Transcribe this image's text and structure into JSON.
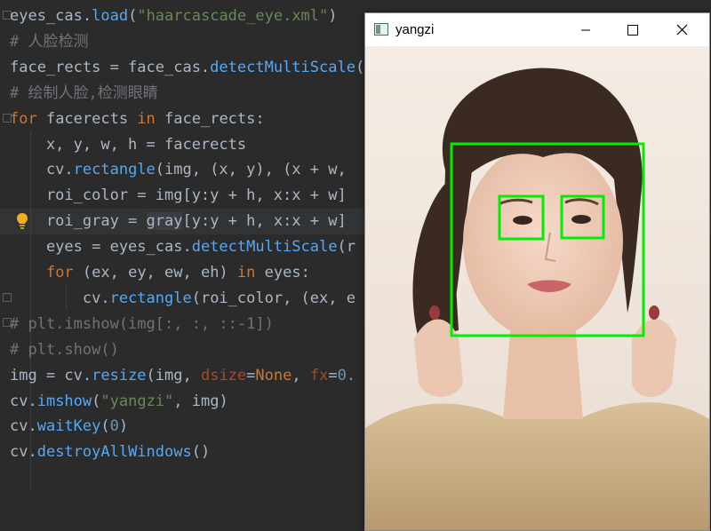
{
  "editor": {
    "lines": [
      {
        "parts": [
          {
            "t": "eyes_cas.",
            "c": ""
          },
          {
            "t": "load",
            "c": "fn"
          },
          {
            "t": "(",
            "c": ""
          },
          {
            "t": "\"haarcascade_eye.xml\"",
            "c": "str"
          },
          {
            "t": ")",
            "c": ""
          }
        ]
      },
      {
        "parts": [
          {
            "t": "# 人脸检测",
            "c": "cmt"
          }
        ]
      },
      {
        "parts": [
          {
            "t": "face_rects = face_cas.",
            "c": ""
          },
          {
            "t": "detectMultiScale",
            "c": "fn"
          },
          {
            "t": "(",
            "c": ""
          }
        ]
      },
      {
        "parts": [
          {
            "t": "# 绘制人脸,检测眼睛",
            "c": "cmt"
          }
        ]
      },
      {
        "parts": [
          {
            "t": "for",
            "c": "kw"
          },
          {
            "t": " facerects ",
            "c": ""
          },
          {
            "t": "in",
            "c": "kw"
          },
          {
            "t": " face_rects:",
            "c": ""
          }
        ]
      },
      {
        "parts": [
          {
            "t": "    x, y, w, h = facerects",
            "c": ""
          }
        ]
      },
      {
        "parts": [
          {
            "t": "    cv.",
            "c": ""
          },
          {
            "t": "rectangle",
            "c": "fn"
          },
          {
            "t": "(img, (x, y), (x + w,",
            "c": ""
          }
        ]
      },
      {
        "parts": [
          {
            "t": "    roi_color = img[y:y + h, x:x + w]",
            "c": ""
          }
        ]
      },
      {
        "parts": [
          {
            "t": "    roi_gray = ",
            "c": ""
          },
          {
            "t": "gray",
            "c": "gray-hl"
          },
          {
            "t": "[y:y + h, x:x + w]",
            "c": ""
          }
        ]
      },
      {
        "parts": [
          {
            "t": "    eyes = eyes_cas.",
            "c": ""
          },
          {
            "t": "detectMultiScale",
            "c": "fn"
          },
          {
            "t": "(r",
            "c": ""
          }
        ]
      },
      {
        "parts": [
          {
            "t": "    ",
            "c": ""
          },
          {
            "t": "for",
            "c": "kw"
          },
          {
            "t": " (ex, ey, ew, eh) ",
            "c": ""
          },
          {
            "t": "in",
            "c": "kw"
          },
          {
            "t": " eyes:",
            "c": ""
          }
        ]
      },
      {
        "parts": [
          {
            "t": "        cv.",
            "c": ""
          },
          {
            "t": "rectangle",
            "c": "fn"
          },
          {
            "t": "(roi_color, (ex, e",
            "c": ""
          }
        ]
      },
      {
        "parts": [
          {
            "t": "# plt.imshow(img[:, :, ::-1])",
            "c": "cmt"
          }
        ]
      },
      {
        "parts": [
          {
            "t": "# plt.show()",
            "c": "cmt"
          }
        ]
      },
      {
        "parts": [
          {
            "t": "img = cv.",
            "c": ""
          },
          {
            "t": "resize",
            "c": "fn"
          },
          {
            "t": "(img, ",
            "c": ""
          },
          {
            "t": "dsize",
            "c": "param"
          },
          {
            "t": "=",
            "c": ""
          },
          {
            "t": "None",
            "c": "kw"
          },
          {
            "t": ", ",
            "c": ""
          },
          {
            "t": "fx",
            "c": "param"
          },
          {
            "t": "=",
            "c": ""
          },
          {
            "t": "0.",
            "c": "num"
          }
        ]
      },
      {
        "parts": [
          {
            "t": "cv.",
            "c": ""
          },
          {
            "t": "imshow",
            "c": "fn"
          },
          {
            "t": "(",
            "c": ""
          },
          {
            "t": "\"yangzi\"",
            "c": "str"
          },
          {
            "t": ", img)",
            "c": ""
          }
        ]
      },
      {
        "parts": [
          {
            "t": "cv.",
            "c": ""
          },
          {
            "t": "waitKey",
            "c": "fn"
          },
          {
            "t": "(",
            "c": ""
          },
          {
            "t": "0",
            "c": "num"
          },
          {
            "t": ")",
            "c": ""
          }
        ]
      },
      {
        "parts": [
          {
            "t": "cv.",
            "c": ""
          },
          {
            "t": "destroyAllWindows",
            "c": "fn"
          },
          {
            "t": "()",
            "c": ""
          }
        ]
      }
    ]
  },
  "window": {
    "title": "yangzi",
    "minimize_icon": "minimize-icon",
    "maximize_icon": "maximize-icon",
    "close_icon": "close-icon"
  },
  "detections": {
    "box_color": "#00ee00",
    "face_box": "face",
    "eye_boxes": [
      "left-eye",
      "right-eye"
    ]
  }
}
